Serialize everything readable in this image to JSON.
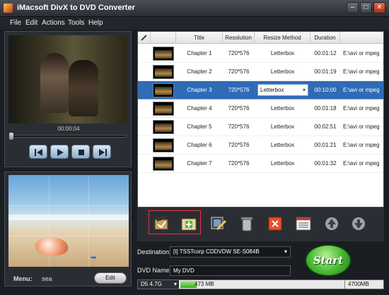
{
  "window": {
    "title": "iMacsoft DivX to DVD Converter"
  },
  "menubar": {
    "items": [
      "File",
      "Edit",
      "Actions",
      "Tools",
      "Help"
    ]
  },
  "player": {
    "time": "00:00:04",
    "progress_fraction": 0.0
  },
  "menu_settings": {
    "menu_key": "Menu:",
    "menu_value": "sea",
    "edit_label": "Edit"
  },
  "file_list": {
    "columns": {
      "title": "Title",
      "resolution": "Resolution",
      "resize": "Resize Method",
      "duration": "Duration"
    },
    "rows": [
      {
        "title": "Chapter 1",
        "resolution": "720*576",
        "resize": "Letterbox",
        "duration": "00:01:12",
        "path": "E:\\avi or mpeg"
      },
      {
        "title": "Chapter 2",
        "resolution": "720*576",
        "resize": "Letterbox",
        "duration": "00:01:19",
        "path": "E:\\avi or mpeg"
      },
      {
        "title": "Chapter 3",
        "resolution": "720*576",
        "resize": "Letterbox",
        "duration": "00:10:00",
        "path": "E:\\avi or mpeg"
      },
      {
        "title": "Chapter 4",
        "resolution": "720*576",
        "resize": "Letterbox",
        "duration": "00:01:18",
        "path": "E:\\avi or mpeg"
      },
      {
        "title": "Chapter 5",
        "resolution": "720*576",
        "resize": "Letterbox",
        "duration": "00:02:51",
        "path": "E:\\avi or mpeg"
      },
      {
        "title": "Chapter 6",
        "resolution": "720*576",
        "resize": "Letterbox",
        "duration": "00:01:21",
        "path": "E:\\avi or mpeg"
      },
      {
        "title": "Chapter 7",
        "resolution": "720*576",
        "resize": "Letterbox",
        "duration": "00:01:32",
        "path": "E:\\avi or mpeg"
      }
    ],
    "selected_index": 2
  },
  "output": {
    "destination_label": "Destination:",
    "destination_value": "[I] TSSTcorp CDDVDW SE-S084B",
    "dvd_name_label": "DVD Name:",
    "dvd_name_value": "My DVD",
    "start_label": "Start"
  },
  "capacity": {
    "disc_type": "D5 4.7G",
    "used": "473 MB",
    "max": "4700MB",
    "used_fraction": 0.1
  },
  "colors": {
    "selected_row": "#2f6bb6",
    "accent_green": "#4bbd34",
    "highlight_border": "#ee3333"
  }
}
